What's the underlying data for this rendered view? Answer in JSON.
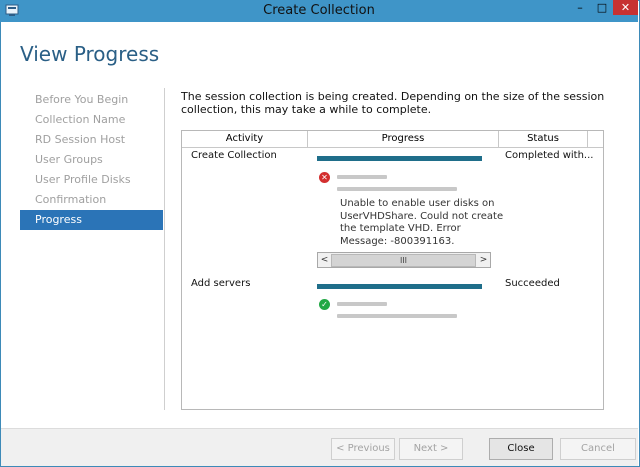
{
  "window": {
    "title": "Create Collection",
    "controls": {
      "minimize": "–",
      "maximize": "□",
      "close": "✕"
    }
  },
  "page": {
    "title": "View Progress"
  },
  "nav": {
    "items": [
      {
        "label": "Before You Begin",
        "active": false
      },
      {
        "label": "Collection Name",
        "active": false
      },
      {
        "label": "RD Session Host",
        "active": false
      },
      {
        "label": "User Groups",
        "active": false
      },
      {
        "label": "User Profile Disks",
        "active": false
      },
      {
        "label": "Confirmation",
        "active": false
      },
      {
        "label": "Progress",
        "active": true
      }
    ]
  },
  "description": "The session collection is being created. Depending on the size of the session collection, this may take a while to complete.",
  "table": {
    "columns": [
      "Activity",
      "Progress",
      "Status"
    ],
    "rows": [
      {
        "activity": "Create Collection",
        "progress": 1.0,
        "status": "Completed with...",
        "result_icon": "error-icon",
        "message": "Unable to enable user disks on UserVHDShare. Could not create the template VHD. Error Message: -800391163."
      },
      {
        "activity": "Add servers",
        "progress": 1.0,
        "status": "Succeeded",
        "result_icon": "success-icon"
      }
    ],
    "scrollbar": {
      "left_arrow": "<",
      "right_arrow": ">",
      "thumb_grip": "III"
    }
  },
  "footer": {
    "previous": "< Previous",
    "next": "Next >",
    "close": "Close",
    "cancel": "Cancel"
  },
  "colors": {
    "titlebar": "#3f95c8",
    "accent": "#2b74b7",
    "progress_bar": "#1f6e8a",
    "error": "#d32f2f",
    "success": "#22a845"
  }
}
